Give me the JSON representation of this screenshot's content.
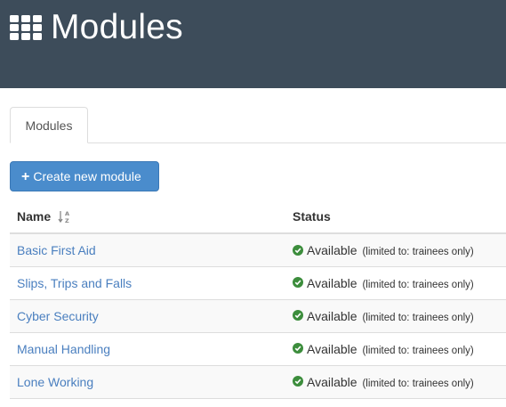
{
  "header": {
    "title": "Modules",
    "icon": "grid-icon"
  },
  "tabs": [
    {
      "label": "Modules",
      "active": true
    }
  ],
  "actions": {
    "create_label": "Create new module",
    "create_icon": "plus-icon"
  },
  "table": {
    "columns": {
      "name": "Name",
      "status": "Status"
    },
    "sort_icon": "sort-alpha-asc-icon",
    "rows": [
      {
        "name": "Basic First Aid",
        "status": "Available",
        "note": "(limited to: trainees only)"
      },
      {
        "name": "Slips, Trips and Falls",
        "status": "Available",
        "note": "(limited to: trainees only)"
      },
      {
        "name": "Cyber Security",
        "status": "Available",
        "note": "(limited to: trainees only)"
      },
      {
        "name": "Manual Handling",
        "status": "Available",
        "note": "(limited to: trainees only)"
      },
      {
        "name": "Lone Working",
        "status": "Available",
        "note": "(limited to: trainees only)"
      }
    ]
  },
  "colors": {
    "header_bg": "#3d4c5a",
    "primary_button": "#4a8ccc",
    "link": "#4a7fbf",
    "success": "#3c8d3c"
  }
}
